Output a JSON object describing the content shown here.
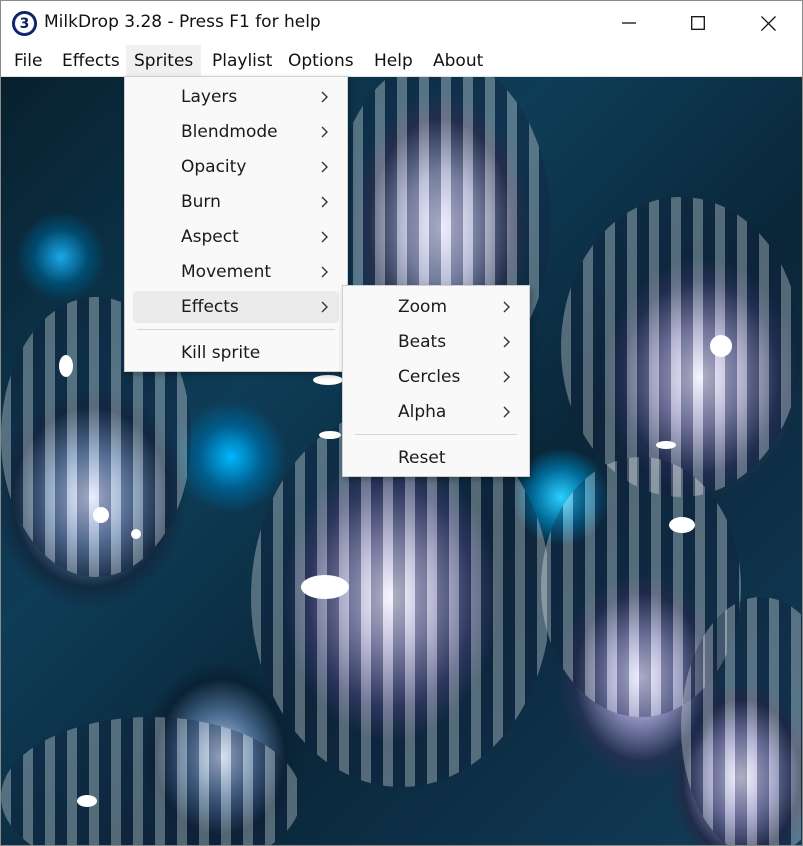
{
  "window": {
    "app_icon_glyph": "3",
    "title": "MilkDrop 3.28 - Press F1 for help"
  },
  "menubar": {
    "items": [
      "File",
      "Effects",
      "Sprites",
      "Playlist",
      "Options",
      "Help",
      "About"
    ],
    "active": "Sprites"
  },
  "sprites_menu": {
    "items": [
      {
        "label": "Layers",
        "submenu": true
      },
      {
        "label": "Blendmode",
        "submenu": true
      },
      {
        "label": "Opacity",
        "submenu": true
      },
      {
        "label": "Burn",
        "submenu": true
      },
      {
        "label": "Aspect",
        "submenu": true
      },
      {
        "label": "Movement",
        "submenu": true
      },
      {
        "label": "Effects",
        "submenu": true,
        "highlighted": true
      },
      {
        "label": "Kill sprite",
        "submenu": false
      }
    ]
  },
  "effects_submenu": {
    "items": [
      {
        "label": "Zoom",
        "submenu": true
      },
      {
        "label": "Beats",
        "submenu": true
      },
      {
        "label": "Cercles",
        "submenu": true
      },
      {
        "label": "Alpha",
        "submenu": true
      },
      {
        "label": "Reset",
        "submenu": false
      }
    ]
  },
  "icons": {
    "minimize": "minimize-icon",
    "maximize": "maximize-icon",
    "close": "close-icon",
    "submenu_arrow": "chevron-right-icon"
  },
  "colors": {
    "menu_bg": "#f9f9f9",
    "menu_highlight": "#ebebeb",
    "visualizer_dark": "#0a2638",
    "visualizer_cyan": "#00b6ff"
  }
}
